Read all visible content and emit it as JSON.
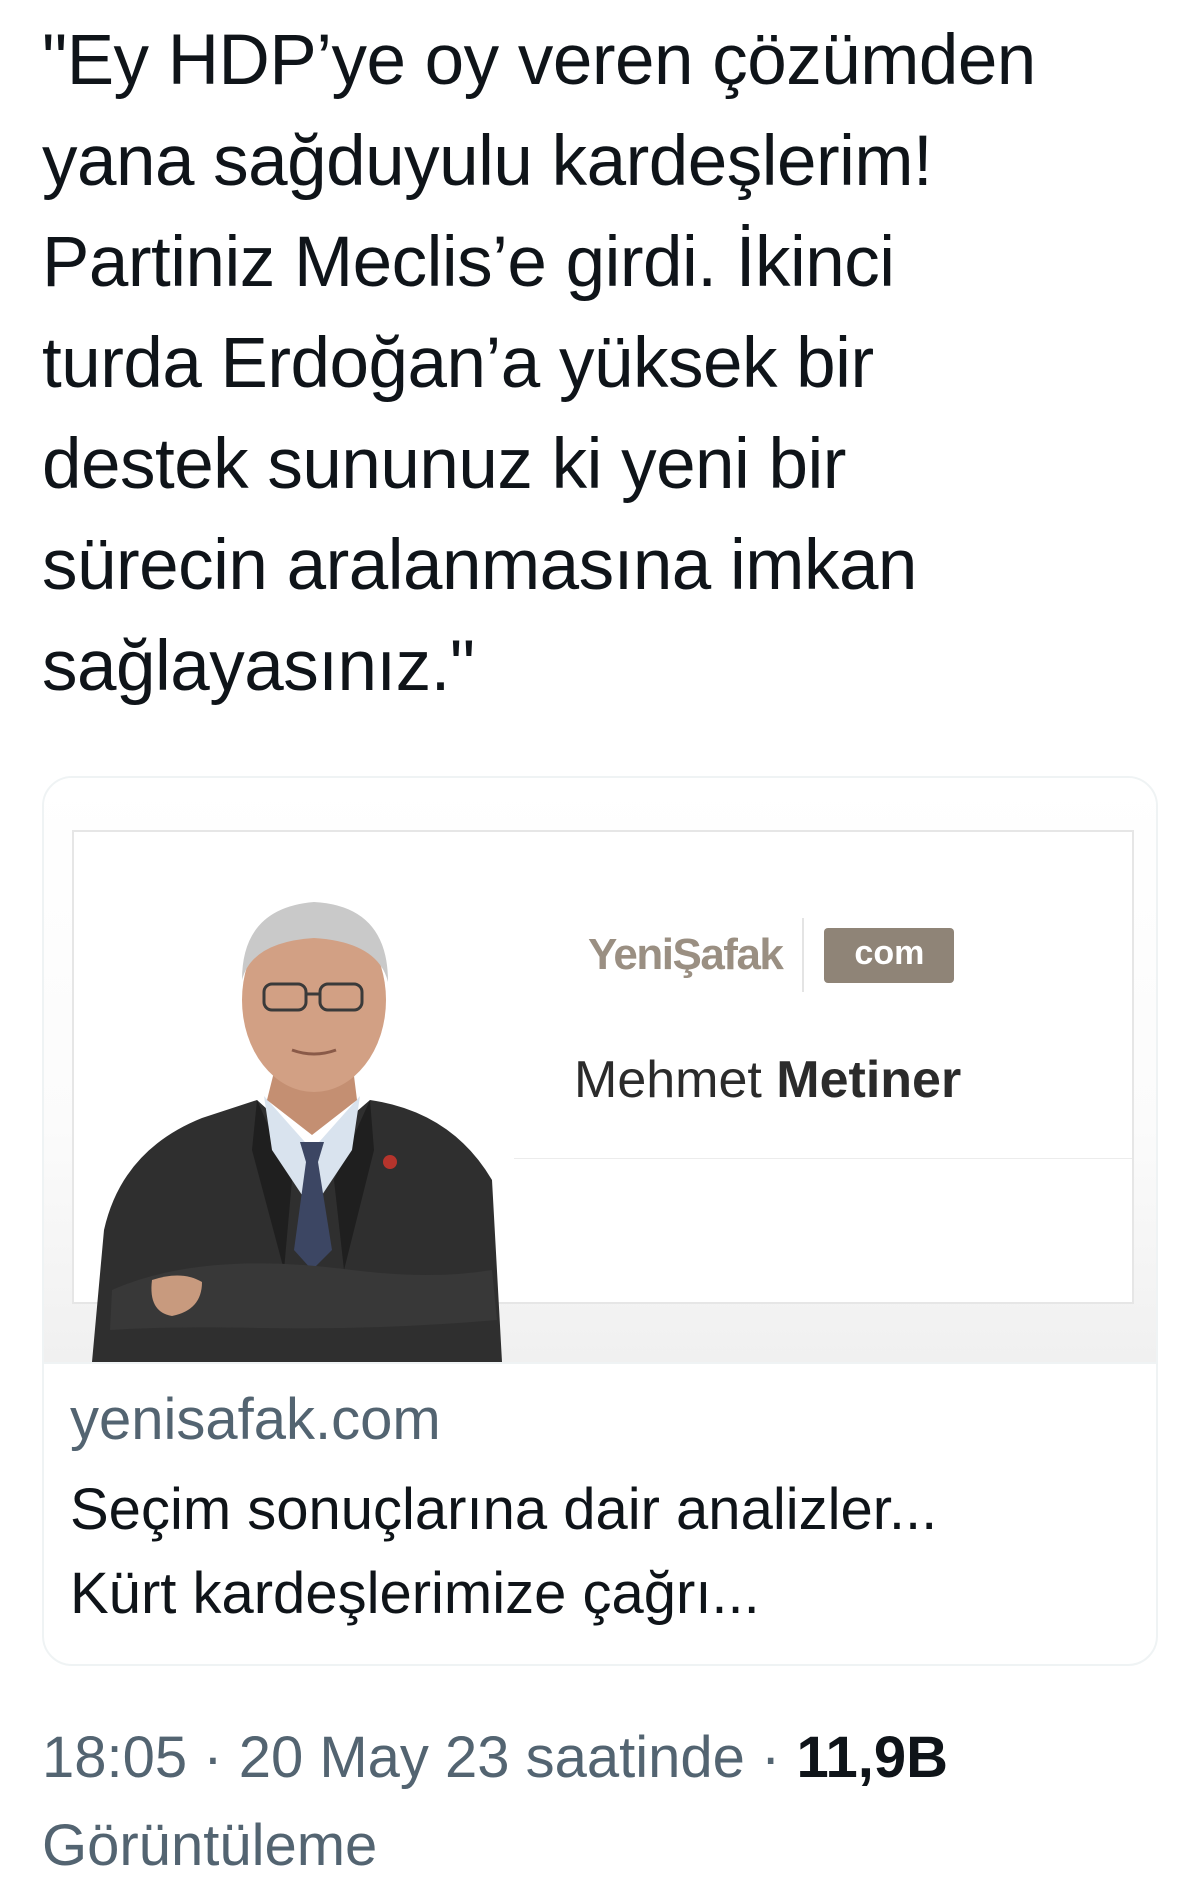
{
  "tweet": {
    "text": "\"Ey HDP’ye oy veren çözümden\nyana sağduyulu kardeşlerim!\nPartiniz Meclis’e girdi. İkinci\nturda Erdoğan’a yüksek bir\ndestek sununuz ki yeni bir\nsürecin aralanmasına imkan\nsağlayasınız.\""
  },
  "card": {
    "brand_logo": "YeniŞafak",
    "brand_badge": "com",
    "author_first": "Mehmet",
    "author_last": "Metiner",
    "domain": "yenisafak.com",
    "title": "Seçim sonuçlarına dair analizler...\nKürt kardeşlerimize çağrı..."
  },
  "meta": {
    "time": "18:05",
    "separator": " · ",
    "date": "20 May 23 saatinde",
    "views_count": "11,9B",
    "views_label": "Görüntüleme"
  },
  "colors": {
    "text_primary": "#0f1419",
    "text_secondary": "#536471",
    "brand": "#9a8f82",
    "suit": "#2f2f2f"
  }
}
